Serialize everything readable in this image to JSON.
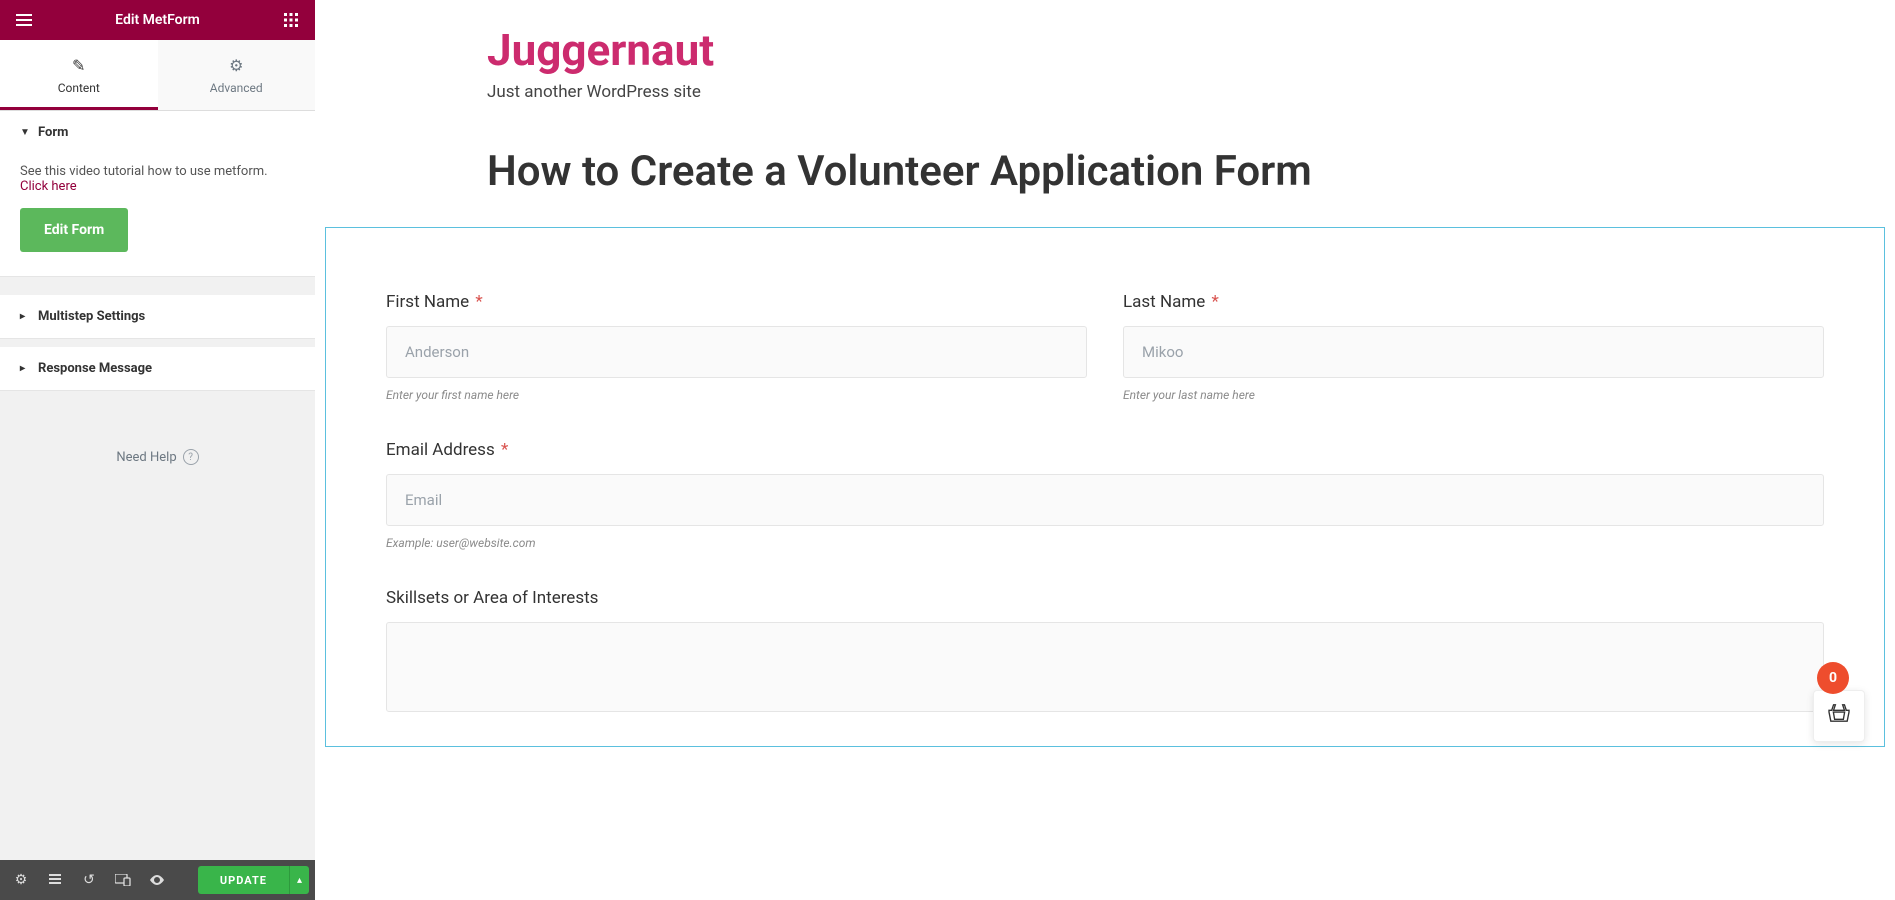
{
  "header": {
    "title": "Edit MetForm"
  },
  "tabs": {
    "content": "Content",
    "advanced": "Advanced"
  },
  "panel": {
    "form_section": "Form",
    "tutorial_text": "See this video tutorial how to use metform. ",
    "tutorial_link": "Click here",
    "edit_form_btn": "Edit Form",
    "multistep": "Multistep Settings",
    "response": "Response Message",
    "need_help": "Need Help"
  },
  "footer": {
    "update": "UPDATE"
  },
  "site": {
    "title": "Juggernaut",
    "tagline": "Just another WordPress site",
    "page_title": "How to Create a Volunteer Application Form"
  },
  "form": {
    "first_name": {
      "label": "First Name",
      "placeholder": "Anderson",
      "help": "Enter your first name here"
    },
    "last_name": {
      "label": "Last Name",
      "placeholder": "Mikoo",
      "help": "Enter your last name here"
    },
    "email": {
      "label": "Email Address",
      "placeholder": "Email",
      "help": "Example: user@website.com"
    },
    "skills": {
      "label": "Skillsets or Area of Interests"
    }
  },
  "cart": {
    "count": "0"
  }
}
